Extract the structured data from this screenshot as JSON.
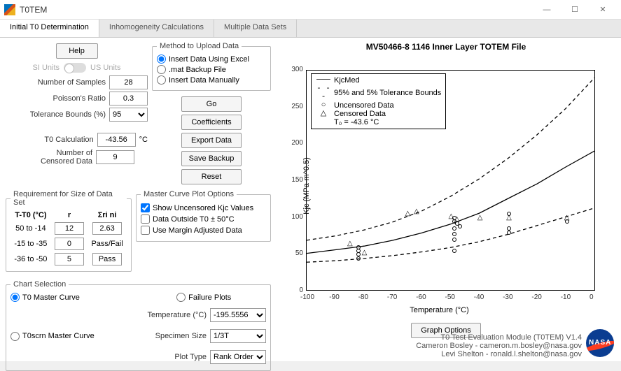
{
  "window": {
    "title": "T0TEM"
  },
  "tabs": [
    "Initial T0 Determination",
    "Inhomogeneity Calculations",
    "Multiple Data Sets"
  ],
  "active_tab": 0,
  "help_label": "Help",
  "units": {
    "si": "SI Units",
    "us": "US Units"
  },
  "inputs": {
    "num_samples_label": "Number of Samples",
    "num_samples": "28",
    "poisson_label": "Poisson's Ratio",
    "poisson": "0.3",
    "tol_label": "Tolerance Bounds (%)",
    "tol": "95",
    "t0_calc_label": "T0 Calculation",
    "t0_calc": "-43.56",
    "t0_unit": "°C",
    "censored_label": "Number of Censored Data",
    "censored": "9"
  },
  "upload": {
    "legend": "Method to Upload Data",
    "opt1": "Insert Data Using Excel",
    "opt2": ".mat Backup File",
    "opt3": "Insert Data Manually",
    "go": "Go",
    "coeff": "Coefficients",
    "export": "Export Data",
    "save": "Save Backup",
    "reset": "Reset"
  },
  "req": {
    "legend": "Requirement for Size of Data Set",
    "h1": "T-T0 (°C)",
    "h2": "r",
    "h3": "Σri ni",
    "r1c1": "50 to -14",
    "r1c2": "12",
    "r1c3": "2.63",
    "r2c1": "-15 to -35",
    "r2c2": "0",
    "r2c3_label": "Pass/Fail",
    "r3c1": "-36 to -50",
    "r3c2": "5",
    "r3c3": "Pass"
  },
  "master_opts": {
    "legend": "Master Curve Plot Options",
    "c1": "Show Uncensored Kjc Values",
    "c2": "Data Outside T0 ± 50°C",
    "c3": "Use Margin Adjusted Data"
  },
  "chart_sel": {
    "legend": "Chart Selection",
    "r1": "T0 Master Curve",
    "r2": "Failure Plots",
    "r3": "T0scrn Master Curve",
    "temp_label": "Temperature (°C)",
    "temp": "-195.5556",
    "spec_label": "Specimen Size",
    "spec": "1/3T",
    "plot_label": "Plot Type",
    "plot": "Rank Order"
  },
  "chart": {
    "title": "MV50466-8 1146 Inner Layer TOTEM File",
    "xlabel": "Temperature (°C)",
    "ylabel": "Kjc (MPa·m^0.5)",
    "legend": {
      "l1": "KjcMed",
      "l2": "95% and 5% Tolerance Bounds",
      "l3": "Uncensored Data",
      "l4": "Censored Data",
      "l5": "T₀ =  -43.6  °C"
    },
    "graph_opts": "Graph Options",
    "xticks": [
      "-100",
      "-90",
      "-80",
      "-70",
      "-60",
      "-50",
      "-40",
      "-30",
      "-20",
      "-10",
      "0"
    ],
    "yticks": [
      "0",
      "50",
      "100",
      "150",
      "200",
      "250",
      "300"
    ]
  },
  "chart_data": {
    "type": "line",
    "xlim": [
      -100,
      0
    ],
    "ylim": [
      0,
      300
    ],
    "x": [
      -100,
      -90,
      -80,
      -70,
      -60,
      -50,
      -40,
      -30,
      -20,
      -10,
      0
    ],
    "series": [
      {
        "name": "KjcMed",
        "values": [
          50,
          55,
          60,
          68,
          78,
          90,
          105,
          125,
          145,
          168,
          190
        ]
      },
      {
        "name": "95% Bound",
        "values": [
          68,
          74,
          82,
          93,
          108,
          128,
          152,
          180,
          212,
          248,
          290
        ]
      },
      {
        "name": "5% Bound",
        "values": [
          38,
          40,
          43,
          47,
          52,
          58,
          66,
          76,
          88,
          100,
          112
        ]
      }
    ],
    "uncensored": [
      {
        "x": -82,
        "y": 55
      },
      {
        "x": -82,
        "y": 50
      },
      {
        "x": -82,
        "y": 45
      },
      {
        "x": -82,
        "y": 60
      },
      {
        "x": -49,
        "y": 95
      },
      {
        "x": -49,
        "y": 100
      },
      {
        "x": -49,
        "y": 85
      },
      {
        "x": -49,
        "y": 78
      },
      {
        "x": -49,
        "y": 70
      },
      {
        "x": -49,
        "y": 55
      },
      {
        "x": -48,
        "y": 92
      },
      {
        "x": -47,
        "y": 88
      },
      {
        "x": -30,
        "y": 105
      },
      {
        "x": -30,
        "y": 85
      },
      {
        "x": -30,
        "y": 80
      },
      {
        "x": -10,
        "y": 95
      }
    ],
    "censored": [
      {
        "x": -85,
        "y": 65
      },
      {
        "x": -80,
        "y": 52
      },
      {
        "x": -65,
        "y": 105
      },
      {
        "x": -62,
        "y": 108
      },
      {
        "x": -50,
        "y": 102
      },
      {
        "x": -48,
        "y": 98
      },
      {
        "x": -40,
        "y": 100
      },
      {
        "x": -30,
        "y": 100
      },
      {
        "x": -10,
        "y": 100
      }
    ]
  },
  "footer": {
    "l1": "T0 Test Evaluation Module (T0TEM) V1.4",
    "l2": "Cameron Bosley - cameron.m.bosley@nasa.gov",
    "l3": "Levi Shelton - ronald.l.shelton@nasa.gov"
  }
}
